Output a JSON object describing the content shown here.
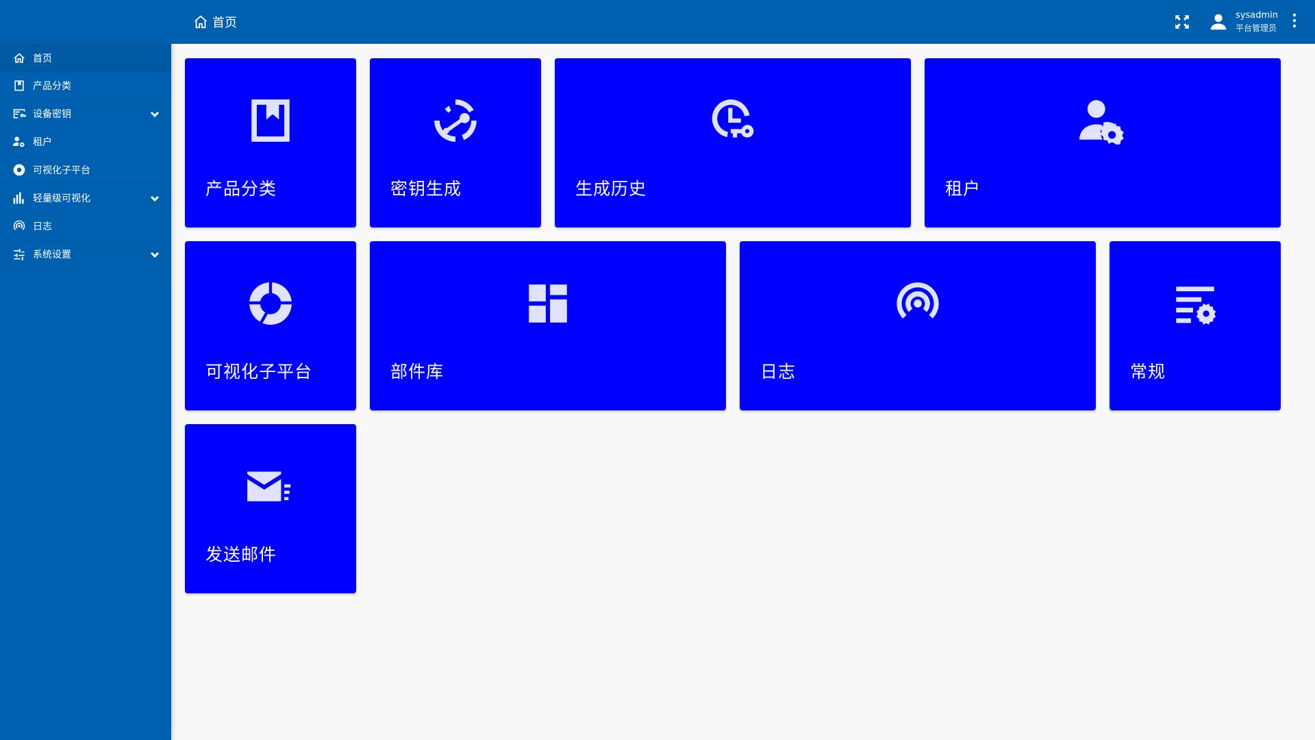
{
  "header": {
    "breadcrumb": "首页",
    "home_icon": "home-icon",
    "fullscreen_icon": "fullscreen-icon",
    "user": {
      "name": "sysadmin",
      "role": "平台管理员",
      "avatar_icon": "account-icon"
    },
    "more_icon": "more-vertical-icon"
  },
  "sidebar": {
    "items": [
      {
        "label": "首页",
        "icon": "home-icon",
        "expandable": false,
        "active": true
      },
      {
        "label": "产品分类",
        "icon": "bookmark-box-icon",
        "expandable": false
      },
      {
        "label": "设备密钥",
        "icon": "device-key-icon",
        "expandable": true
      },
      {
        "label": "租户",
        "icon": "tenant-icon",
        "expandable": false
      },
      {
        "label": "可视化子平台",
        "icon": "donut-icon",
        "expandable": false
      },
      {
        "label": "轻量级可视化",
        "icon": "bar-chart-icon",
        "expandable": true
      },
      {
        "label": "日志",
        "icon": "broadcast-icon",
        "expandable": false
      },
      {
        "label": "系统设置",
        "icon": "tune-icon",
        "expandable": true
      }
    ]
  },
  "tiles": [
    {
      "label": "产品分类",
      "icon": "bookmark-box-icon"
    },
    {
      "label": "密钥生成",
      "icon": "key-refresh-icon"
    },
    {
      "label": "生成历史",
      "icon": "clock-key-icon"
    },
    {
      "label": "租户",
      "icon": "account-cog-icon"
    },
    {
      "label": "可视化子平台",
      "icon": "donut-icon"
    },
    {
      "label": "部件库",
      "icon": "widgets-icon"
    },
    {
      "label": "日志",
      "icon": "broadcast-icon"
    },
    {
      "label": "常规",
      "icon": "text-settings-icon"
    },
    {
      "label": "发送邮件",
      "icon": "email-send-icon"
    }
  ],
  "colors": {
    "primary": "#0060b0",
    "tile": "#0000ff",
    "tile_icon": "#dfe3ff",
    "background": "#f8f8f8"
  }
}
